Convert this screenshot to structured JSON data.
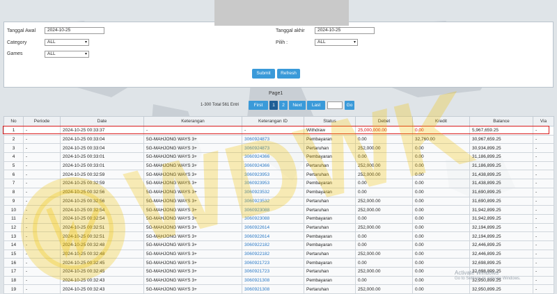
{
  "filters": {
    "start_label": "Tanggal Awal",
    "start_value": "2024-10-25",
    "end_label": "Tanggal akhir",
    "end_value": "2024-10-25",
    "category_label": "Category",
    "category_value": "ALL",
    "games_label": "Games",
    "games_value": "ALL",
    "pilih_label": "Pilih :",
    "pilih_value": "ALL",
    "submit_label": "Submit",
    "refresh_label": "Refresh"
  },
  "pager": {
    "title": "Page1",
    "total_text": "1-300 Total 561 Entri",
    "first": "First",
    "page1": "1",
    "page2": "2",
    "next": "Next",
    "last": "Last",
    "go": "Go"
  },
  "table": {
    "headers": [
      "No",
      "Periode",
      "Date",
      "Keterangan",
      "Keterangan ID",
      "Status",
      "Debet",
      "Kredit",
      "Balance",
      "Via"
    ],
    "rows": [
      [
        "1",
        "-",
        "2024-10-25 00:33:37",
        "-",
        "-",
        "Withdraw",
        "25,000,000.00",
        "0.00",
        "5,967,659.25",
        "-"
      ],
      [
        "2",
        "-",
        "2024-10-25 00:33:04",
        "5G-MAHJONG WAYS 3+",
        "3060924873",
        "Pembayaran",
        "0.00",
        "32,760.00",
        "30,967,659.25",
        "-"
      ],
      [
        "3",
        "-",
        "2024-10-25 00:33:04",
        "5G-MAHJONG WAYS 3+",
        "3060924873",
        "Pertaruhan",
        "252,000.00",
        "0.00",
        "30,934,899.25",
        "-"
      ],
      [
        "4",
        "-",
        "2024-10-25 00:33:01",
        "5G-MAHJONG WAYS 3+",
        "3060924366",
        "Pembayaran",
        "0.00",
        "0.00",
        "31,186,899.25",
        "-"
      ],
      [
        "5",
        "-",
        "2024-10-25 00:33:01",
        "5G-MAHJONG WAYS 3+",
        "3060924366",
        "Pertaruhan",
        "252,000.00",
        "0.00",
        "31,186,899.25",
        "-"
      ],
      [
        "6",
        "-",
        "2024-10-25 00:32:59",
        "5G-MAHJONG WAYS 3+",
        "3060923953",
        "Pertaruhan",
        "252,000.00",
        "0.00",
        "31,438,899.25",
        "-"
      ],
      [
        "7",
        "-",
        "2024-10-25 00:32:59",
        "5G-MAHJONG WAYS 3+",
        "3060923953",
        "Pembayaran",
        "0.00",
        "0.00",
        "31,438,899.25",
        "-"
      ],
      [
        "8",
        "-",
        "2024-10-25 00:32:56",
        "5G-MAHJONG WAYS 3+",
        "3060923532",
        "Pembayaran",
        "0.00",
        "0.00",
        "31,690,899.25",
        "-"
      ],
      [
        "9",
        "-",
        "2024-10-25 00:32:56",
        "5G-MAHJONG WAYS 3+",
        "3060923532",
        "Pertaruhan",
        "252,000.00",
        "0.00",
        "31,690,899.25",
        "-"
      ],
      [
        "10",
        "-",
        "2024-10-25 00:32:54",
        "5G-MAHJONG WAYS 3+",
        "3060923088",
        "Pertaruhan",
        "252,000.00",
        "0.00",
        "31,942,899.25",
        "-"
      ],
      [
        "11",
        "-",
        "2024-10-25 00:32:54",
        "5G-MAHJONG WAYS 3+",
        "3060923088",
        "Pembayaran",
        "0.00",
        "0.00",
        "31,942,899.25",
        "-"
      ],
      [
        "12",
        "-",
        "2024-10-25 00:32:51",
        "5G-MAHJONG WAYS 3+",
        "3060922614",
        "Pertaruhan",
        "252,000.00",
        "0.00",
        "32,194,899.25",
        "-"
      ],
      [
        "13",
        "-",
        "2024-10-25 00:32:51",
        "5G-MAHJONG WAYS 3+",
        "3060922614",
        "Pembayaran",
        "0.00",
        "0.00",
        "32,194,899.25",
        "-"
      ],
      [
        "14",
        "-",
        "2024-10-25 00:32:48",
        "5G-MAHJONG WAYS 3+",
        "3060922182",
        "Pembayaran",
        "0.00",
        "0.00",
        "32,446,899.25",
        "-"
      ],
      [
        "15",
        "-",
        "2024-10-25 00:32:48",
        "5G-MAHJONG WAYS 3+",
        "3060922182",
        "Pertaruhan",
        "252,000.00",
        "0.00",
        "32,446,899.25",
        "-"
      ],
      [
        "16",
        "-",
        "2024-10-25 00:32:45",
        "5G-MAHJONG WAYS 3+",
        "3060921723",
        "Pembayaran",
        "0.00",
        "0.00",
        "32,698,899.25",
        "-"
      ],
      [
        "17",
        "-",
        "2024-10-25 00:32:45",
        "5G-MAHJONG WAYS 3+",
        "3060921723",
        "Pertaruhan",
        "252,000.00",
        "0.00",
        "32,698,899.25",
        "-"
      ],
      [
        "18",
        "-",
        "2024-10-25 00:32:43",
        "5G-MAHJONG WAYS 3+",
        "3060921308",
        "Pembayaran",
        "0.00",
        "0.00",
        "32,950,899.25",
        "-"
      ],
      [
        "19",
        "-",
        "2024-10-25 00:32:43",
        "5G-MAHJONG WAYS 3+",
        "3060921308",
        "Pertaruhan",
        "252,000.00",
        "0.00",
        "32,950,899.25",
        "-"
      ]
    ]
  },
  "watermark": {
    "text": "WDWK"
  },
  "activate_windows": {
    "line1": "Activate Windows",
    "line2": "Go to Settings to activate Windows."
  },
  "colors": {
    "accent": "#3a9ad9",
    "highlight": "#d81b1b",
    "link": "#2a78c4",
    "watermark": "#f2c200"
  }
}
